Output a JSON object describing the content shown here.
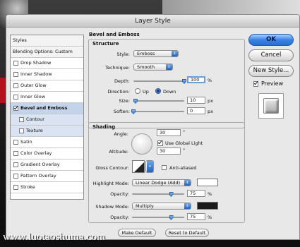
{
  "window": {
    "title": "Layer Style"
  },
  "styles_list": {
    "header": "Styles",
    "blending_options": "Blending Options: Custom",
    "items": [
      {
        "label": "Drop Shadow",
        "checked": false
      },
      {
        "label": "Inner Shadow",
        "checked": false
      },
      {
        "label": "Outer Glow",
        "checked": false
      },
      {
        "label": "Inner Glow",
        "checked": false
      },
      {
        "label": "Bevel and Emboss",
        "checked": true,
        "selected": true
      },
      {
        "label": "Contour",
        "checked": false,
        "sub": true
      },
      {
        "label": "Texture",
        "checked": false,
        "sub": true
      },
      {
        "label": "Satin",
        "checked": false
      },
      {
        "label": "Color Overlay",
        "checked": false
      },
      {
        "label": "Gradient Overlay",
        "checked": false
      },
      {
        "label": "Pattern Overlay",
        "checked": false
      },
      {
        "label": "Stroke",
        "checked": false
      }
    ]
  },
  "bevel": {
    "section_title": "Bevel and Emboss",
    "structure": {
      "title": "Structure",
      "style_label": "Style:",
      "style_value": "Emboss",
      "technique_label": "Technique:",
      "technique_value": "Smooth",
      "depth_label": "Depth:",
      "depth_value": "100",
      "depth_unit": "%",
      "depth_level": 1.0,
      "direction_label": "Direction:",
      "direction_up": "Up",
      "direction_down": "Down",
      "direction_selected": "Down",
      "size_label": "Size:",
      "size_value": "10",
      "size_unit": "px",
      "size_level": 0.04,
      "soften_label": "Soften:",
      "soften_value": "0",
      "soften_unit": "px",
      "soften_level": 0.0
    },
    "shading": {
      "title": "Shading",
      "angle_label": "Angle:",
      "angle_value": "30",
      "angle_unit": "°",
      "use_global_light": "Use Global Light",
      "use_global_light_checked": true,
      "altitude_label": "Altitude:",
      "altitude_value": "30",
      "altitude_unit": "°",
      "gloss_contour_label": "Gloss Contour:",
      "anti_aliased": "Anti-aliased",
      "anti_aliased_checked": false,
      "highlight_mode_label": "Highlight Mode:",
      "highlight_mode_value": "Linear Dodge (Add)",
      "highlight_color": "#ffffff",
      "highlight_opacity_label": "Opacity:",
      "highlight_opacity_value": "75",
      "highlight_opacity_unit": "%",
      "highlight_opacity_level": 0.75,
      "shadow_mode_label": "Shadow Mode:",
      "shadow_mode_value": "Multiply",
      "shadow_color": "#1a1a1a",
      "shadow_opacity_label": "Opacity:",
      "shadow_opacity_value": "75",
      "shadow_opacity_unit": "%",
      "shadow_opacity_level": 0.75
    },
    "make_default": "Make Default",
    "reset_to_default": "Reset to Default"
  },
  "buttons": {
    "ok": "OK",
    "cancel": "Cancel",
    "new_style": "New Style...",
    "preview": "Preview",
    "preview_checked": true
  },
  "watermark": "www.luotaoshuma.com",
  "colors": {
    "accent": "#3a83e2",
    "selection": "#c3d4ea"
  }
}
